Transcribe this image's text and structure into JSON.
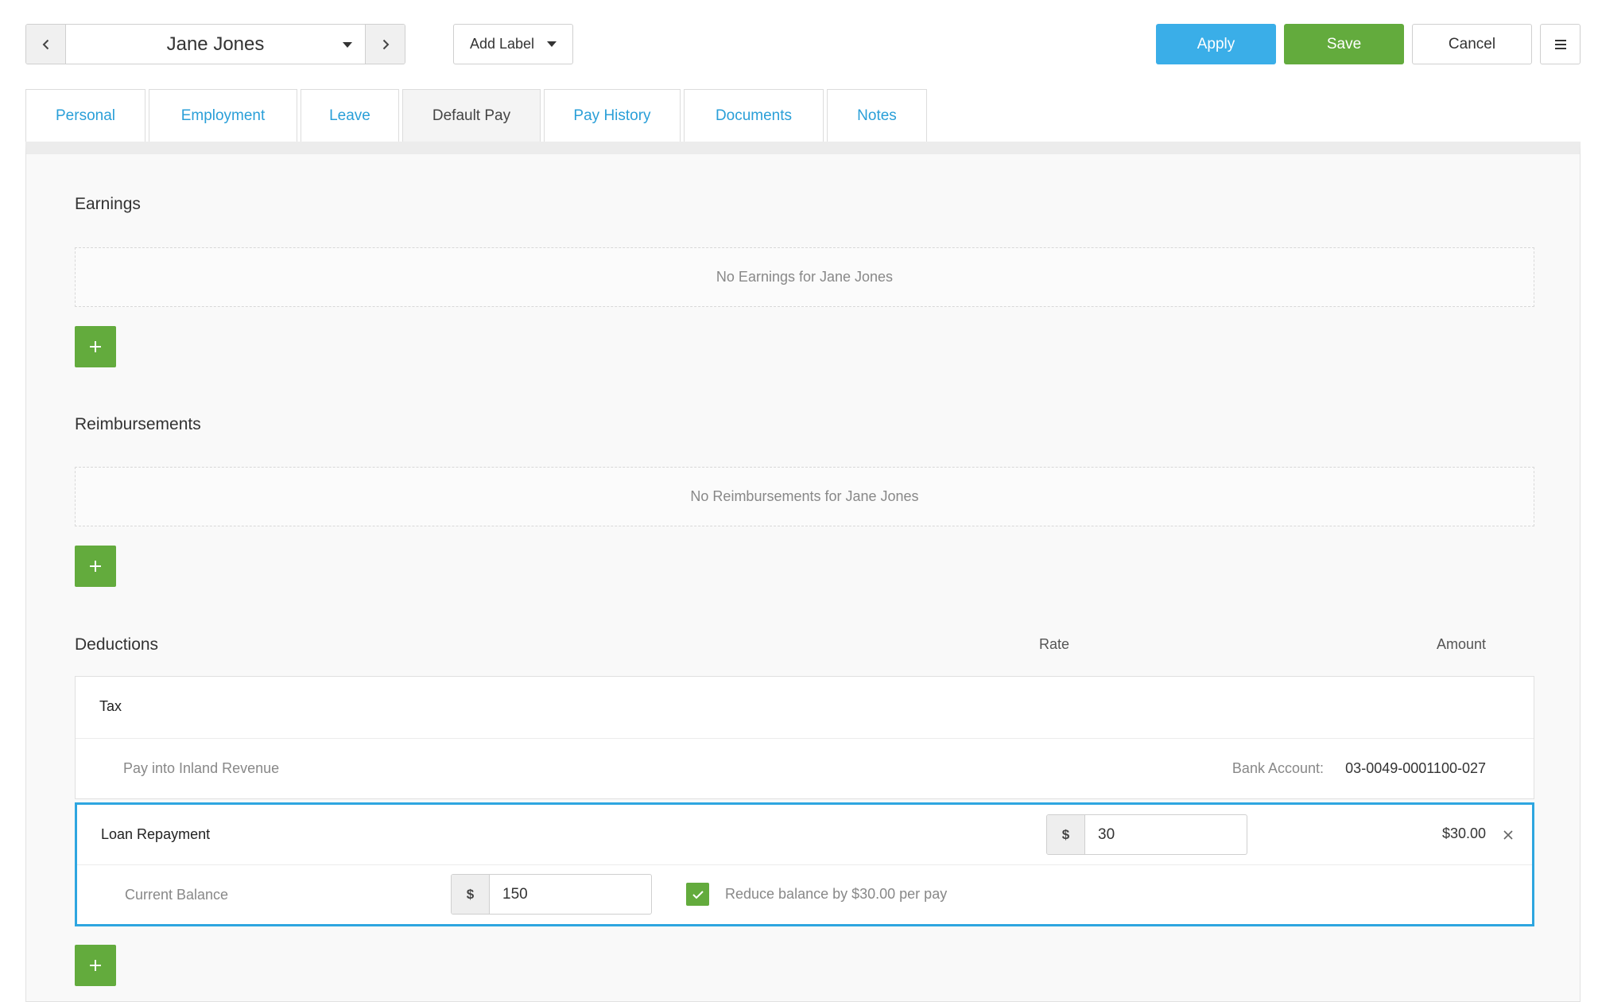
{
  "toolbar": {
    "employee_name": "Jane Jones",
    "add_label": "Add Label",
    "apply_label": "Apply",
    "save_label": "Save",
    "cancel_label": "Cancel"
  },
  "tabs": [
    {
      "label": "Personal",
      "active": false
    },
    {
      "label": "Employment",
      "active": false
    },
    {
      "label": "Leave",
      "active": false
    },
    {
      "label": "Default Pay",
      "active": true
    },
    {
      "label": "Pay History",
      "active": false
    },
    {
      "label": "Documents",
      "active": false
    },
    {
      "label": "Notes",
      "active": false
    }
  ],
  "earnings": {
    "title": "Earnings",
    "empty_text": "No Earnings for Jane Jones"
  },
  "reimbursements": {
    "title": "Reimbursements",
    "empty_text": "No Reimbursements for Jane Jones"
  },
  "deductions": {
    "title": "Deductions",
    "rate_header": "Rate",
    "amount_header": "Amount",
    "tax": {
      "name": "Tax",
      "pay_into": "Pay into Inland Revenue",
      "bank_account_label": "Bank Account:",
      "bank_account_value": "03-0049-0001100-027"
    },
    "loan": {
      "name": "Loan Repayment",
      "rate_currency": "$",
      "rate_value": "30",
      "amount": "$30.00",
      "balance_label": "Current Balance",
      "balance_currency": "$",
      "balance_value": "150",
      "reduce_checked": true,
      "reduce_label": "Reduce balance by $30.00 per pay"
    }
  },
  "colors": {
    "accent_blue": "#3aaee8",
    "accent_green": "#63ab3d",
    "tab_link": "#2a9fd8",
    "highlight_border": "#2ea6e0"
  },
  "icons": {
    "prev": "chevron-left-icon",
    "next": "chevron-right-icon",
    "menu": "hamburger-menu-icon",
    "add": "plus-icon",
    "remove": "close-icon",
    "check": "checkmark-icon"
  }
}
